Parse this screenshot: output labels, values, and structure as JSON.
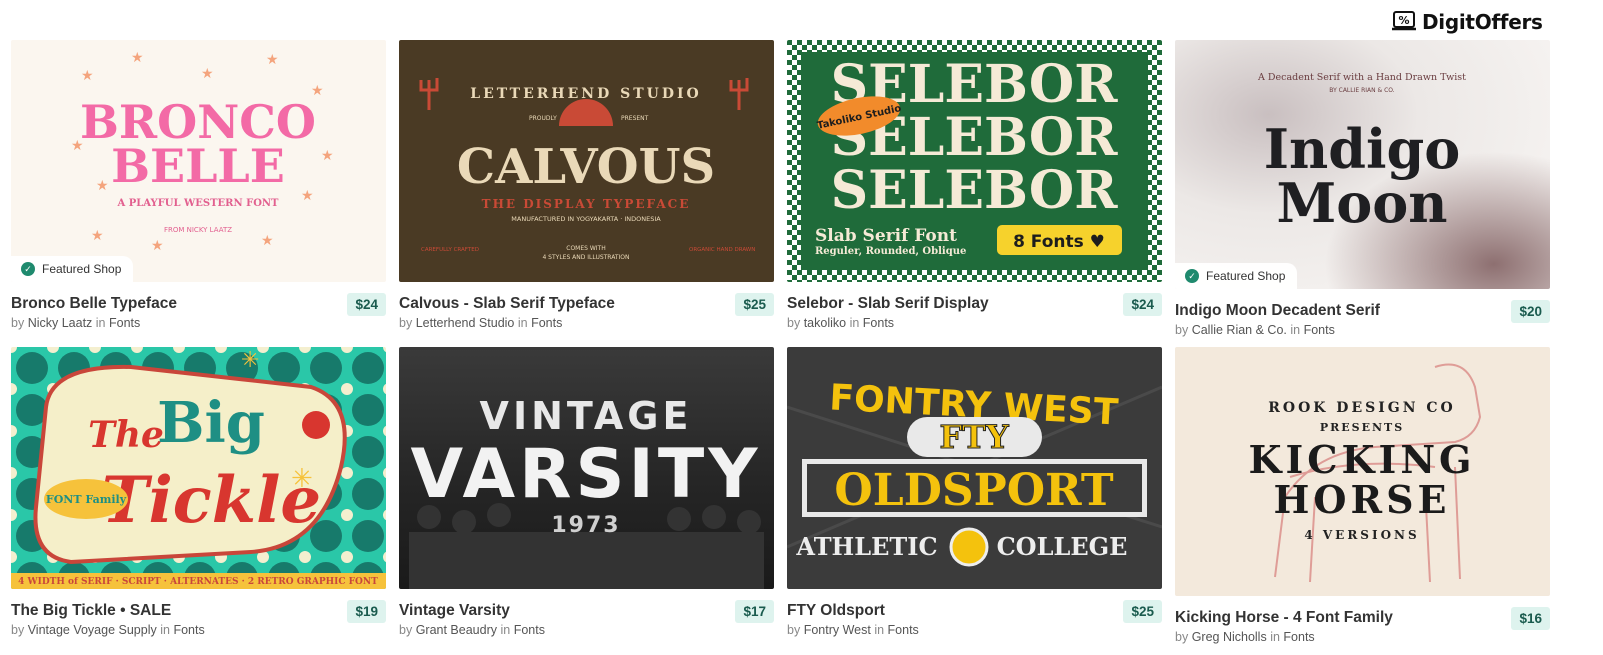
{
  "logo": {
    "text": "DigitOffers",
    "icon": "percent-tag-icon"
  },
  "featured_label": "Featured Shop",
  "by_word": "by",
  "in_word": "in",
  "products": [
    {
      "title": "Bronco Belle Typeface",
      "price": "$24",
      "shop": "Nicky Laatz",
      "category": "Fonts",
      "featured": true,
      "art": {
        "l1": "BRONCO",
        "l2": "BELLE",
        "l3": "A PLAYFUL WESTERN FONT",
        "l4": "FROM NICKY LAATZ"
      }
    },
    {
      "title": "Calvous - Slab Serif Typeface",
      "price": "$25",
      "shop": "Letterhend Studio",
      "category": "Fonts",
      "featured": false,
      "art": {
        "l1": "LETTERHEND STUDIO",
        "l2": "CALVOUS",
        "l3": "THE DISPLAY TYPEFACE",
        "l4": "MANUFACTURED IN YOGYAKARTA · INDONESIA",
        "l5": "COMES WITH",
        "l6": "4 STYLES AND ILLUSTRATION",
        "l7": "CAREFULLY CRAFTED",
        "l8": "ORGANIC HAND DRAWN",
        "l9": "PROUDLY",
        "l10": "PRESENT"
      }
    },
    {
      "title": "Selebor - Slab Serif Display",
      "price": "$24",
      "shop": "takoliko",
      "category": "Fonts",
      "featured": false,
      "art": {
        "l1": "SELEBOR",
        "l2": "Slab Serif Font",
        "l3": "Reguler, Rounded, Oblique",
        "l4": "8 Fonts ♥",
        "l5": "Takoliko Studio"
      }
    },
    {
      "title": "Indigo Moon Decadent Serif",
      "price": "$20",
      "shop": "Callie Rian & Co.",
      "category": "Fonts",
      "featured": true,
      "art": {
        "l1": "A Decadent Serif with a Hand Drawn Twist",
        "l2": "BY CALLIE RIAN & CO.",
        "l3": "Indigo",
        "l4": "Moon"
      }
    },
    {
      "title": "The Big Tickle • SALE",
      "price": "$19",
      "shop": "Vintage Voyage Supply",
      "category": "Fonts",
      "featured": false,
      "art": {
        "l1": "The",
        "l2": "Big",
        "l3": "Tickle",
        "l4": "FONT Family",
        "l5": "4 WIDTH of SERIF · SCRIPT · ALTERNATES · 2 RETRO GRAPHIC FONT"
      }
    },
    {
      "title": "Vintage Varsity",
      "price": "$17",
      "shop": "Grant Beaudry",
      "category": "Fonts",
      "featured": false,
      "art": {
        "l1": "VINTAGE",
        "l2": "VARSITY",
        "l3": "1973"
      }
    },
    {
      "title": "FTY Oldsport",
      "price": "$25",
      "shop": "Fontry West",
      "category": "Fonts",
      "featured": false,
      "art": {
        "l1": "FONTRY WEST",
        "l2": "FTY",
        "l3": "OLDSPORT",
        "l4": "ATHLETIC",
        "l5": "COLLEGE"
      }
    },
    {
      "title": "Kicking Horse - 4 Font Family",
      "price": "$16",
      "shop": "Greg Nicholls",
      "category": "Fonts",
      "featured": false,
      "art": {
        "l1": "ROOK DESIGN CO",
        "l2": "PRESENTS",
        "l3": "KICKING",
        "l4": "HORSE",
        "l5": "4 VERSIONS"
      }
    }
  ]
}
